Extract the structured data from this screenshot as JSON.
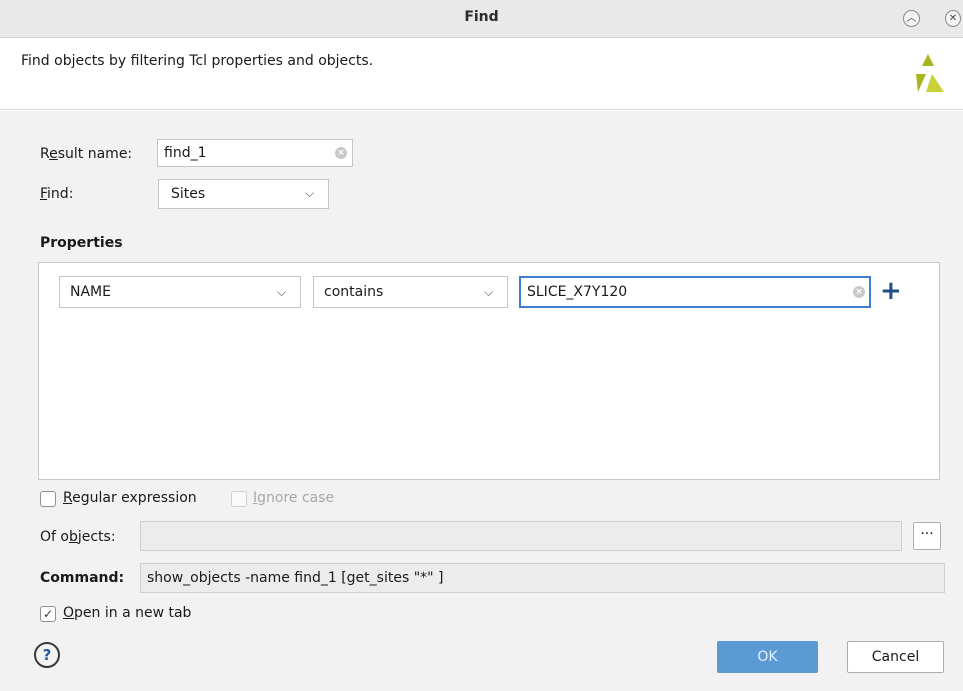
{
  "window": {
    "title": "Find",
    "minimize_icon": "chevron-up-circle",
    "close_icon": "x-circle"
  },
  "header": {
    "description": "Find objects by filtering Tcl properties and objects."
  },
  "form": {
    "result_name": {
      "label_pre": "R",
      "label_mnemonic": "e",
      "label_post": "sult name:",
      "value": "find_1"
    },
    "find": {
      "label_mnemonic": "F",
      "label_post": "ind:",
      "value": "Sites"
    },
    "properties_heading": "Properties",
    "property_row": {
      "property": "NAME",
      "operator": "contains",
      "value": "SLICE_X7Y120",
      "add_icon": "plus"
    },
    "regular_expression": {
      "label_mnemonic": "R",
      "label_post": "egular expression",
      "checked": false
    },
    "ignore_case": {
      "label_mnemonic": "I",
      "label_post": "gnore case",
      "checked": false,
      "enabled": false
    },
    "of_objects": {
      "label_pre": "Of o",
      "label_mnemonic": "b",
      "label_post": "jects:",
      "value": "",
      "browse_label": "···"
    },
    "command": {
      "label": "Command:",
      "value": "show_objects -name find_1 [get_sites \"*\" ]"
    },
    "open_new_tab": {
      "label_mnemonic": "O",
      "label_post": "pen in a new tab",
      "checked": true
    }
  },
  "footer": {
    "help_icon": "?",
    "ok_label": "OK",
    "cancel_label": "Cancel"
  },
  "colors": {
    "primary_button": "#5b9bd5",
    "focus_border": "#3d7fd1",
    "add_icon": "#1f4e8c",
    "logo": "#a8b51c"
  }
}
